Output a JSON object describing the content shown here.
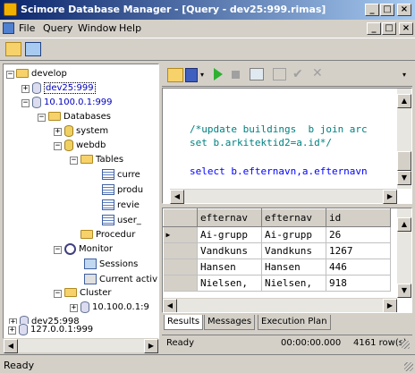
{
  "window": {
    "title": "Scimore Database Manager - [Query - dev25:999.rimas]"
  },
  "menu": {
    "file": "File",
    "query": "Query",
    "window": "Window",
    "help": "Help"
  },
  "tree": {
    "root": "develop",
    "server1": "dev25:999",
    "server2": "10.100.0.1:999",
    "databases": "Databases",
    "system": "system",
    "webdb": "webdb",
    "tables": "Tables",
    "t1": "curre",
    "t2": "produ",
    "t3": "revie",
    "t4": "user_",
    "procedures": "Procedur",
    "monitor": "Monitor",
    "sessions": "Sessions",
    "current": "Current activ",
    "cluster": "Cluster",
    "cnode": "10.100.0.1:9",
    "server3": "dev25:998",
    "server4": "127.0.0.1:999"
  },
  "editor": {
    "line1": "/*update buildings  b join arc",
    "line2": "set b.arkitektid2=a.id*/",
    "line3": "select b.efternavn,a.efternavn"
  },
  "grid": {
    "headers": [
      "efternav",
      "efternav",
      "id"
    ],
    "rows": [
      [
        "Ai-grupp",
        "Ai-grupp",
        "26"
      ],
      [
        "Vandkuns",
        "Vandkuns",
        "1267"
      ],
      [
        "Hansen",
        "Hansen",
        "446"
      ],
      [
        "Nielsen,",
        "Nielsen,",
        "918"
      ]
    ]
  },
  "tabs": {
    "results": "Results",
    "messages": "Messages",
    "plan": "Execution Plan"
  },
  "querystatus": {
    "state": "Ready",
    "time": "00:00:00.000",
    "rows": "4161 row(s)"
  },
  "statusbar": {
    "text": "Ready"
  },
  "colors": {
    "titlebar": "#0a246a",
    "comment": "#008080",
    "keyword": "#0000ff"
  }
}
